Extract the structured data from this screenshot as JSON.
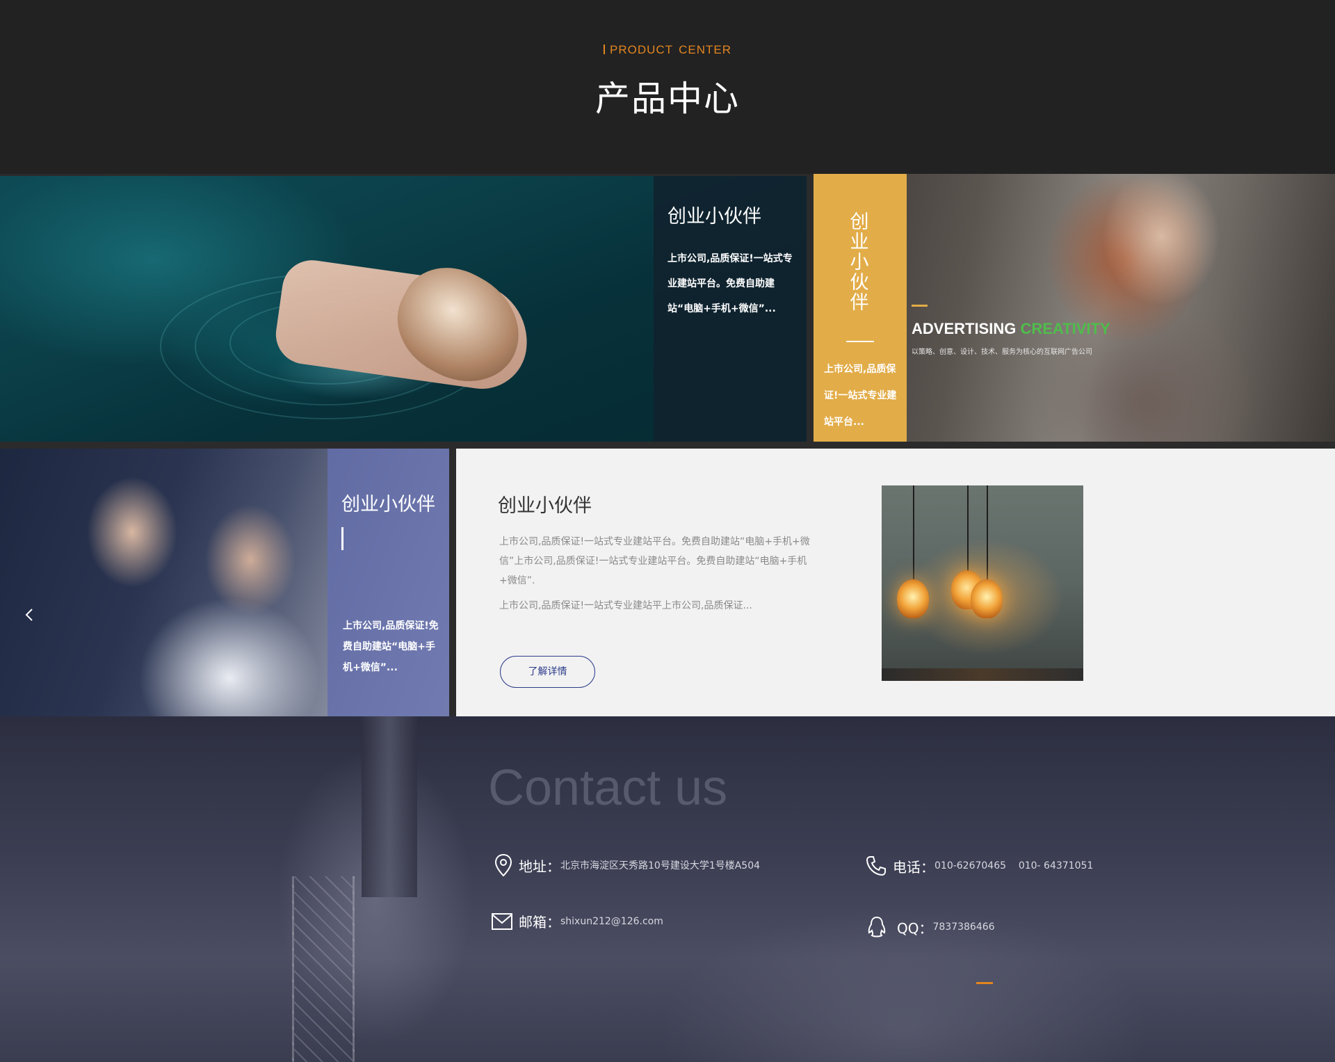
{
  "header": {
    "eyebrow": "PRODUCT",
    "eyebrow2": "CENTER",
    "title": "产品中心"
  },
  "tile_sea": {
    "title": "创业小伙伴",
    "desc": "上市公司,品质保证!一站式专业建站平台。免费自助建站“电脑+手机+微信”..."
  },
  "tile_ad": {
    "vertical_title": "创业小伙伴",
    "desc": "上市公司,品质保证!一站式专业建站平台...",
    "headline_white": "ADVERTISING",
    "headline_green": "CREATIVITY",
    "sub": "以策略、创意、设计、技术、服务为核心的互联网广告公司"
  },
  "tile_business": {
    "title": "创业小伙伴",
    "desc": "上市公司,品质保证!免费自助建站“电脑+手机+微信”..."
  },
  "tile_detail": {
    "title": "创业小伙伴",
    "para1": "上市公司,品质保证!一站式专业建站平台。免费自助建站“电脑+手机+微信”上市公司,品质保证!一站式专业建站平台。免费自助建站“电脑+手机+微信”.",
    "para2": "上市公司,品质保证!一站式专业建站平上市公司,品质保证...",
    "button": "了解详情"
  },
  "contact": {
    "title": "Contact us",
    "address_label": "地址：",
    "address": "北京市海淀区天秀路10号建设大学1号楼A504",
    "phone_label": "电话：",
    "phone": "010-62670465    010- 64371051",
    "email_label": "邮箱：",
    "email": "shixun212@126.com",
    "qq_label": "QQ：",
    "qq": "7837386466"
  },
  "colors": {
    "accent_orange": "#e2861f",
    "yellow_panel": "#e2ac48",
    "blue_panel": "#646fab",
    "green": "#4fbd4c",
    "button_blue": "#2c3b8a"
  },
  "icons": [
    "location-icon",
    "mail-icon",
    "phone-icon",
    "qq-icon",
    "chevron-left-icon"
  ]
}
